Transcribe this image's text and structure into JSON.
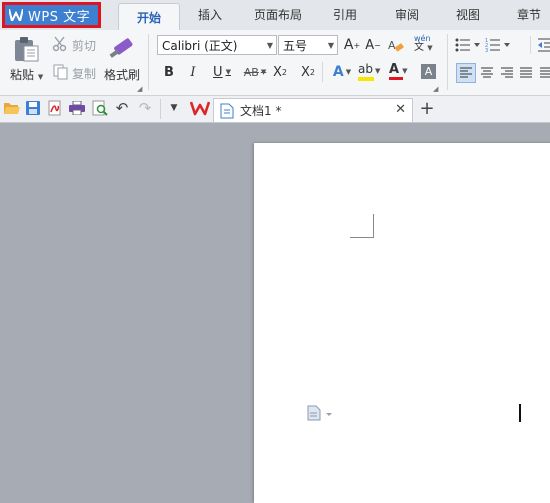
{
  "app": {
    "title": "WPS 文字"
  },
  "menu_tabs": [
    "开始",
    "插入",
    "页面布局",
    "引用",
    "审阅",
    "视图",
    "章节"
  ],
  "clipboard": {
    "paste": "粘贴",
    "cut": "剪切",
    "copy": "复制",
    "format_painter": "格式刷"
  },
  "font": {
    "family": "Calibri (正文)",
    "size": "五号",
    "phonetic": "wén"
  },
  "quick_access": {},
  "document_tab": {
    "name": "文档1 *"
  },
  "colors": {
    "accent": "#3d7fd0",
    "highlight_border": "#e0141e",
    "font_color_bar": "#e0141e",
    "highlight_bar": "#f5e800"
  }
}
